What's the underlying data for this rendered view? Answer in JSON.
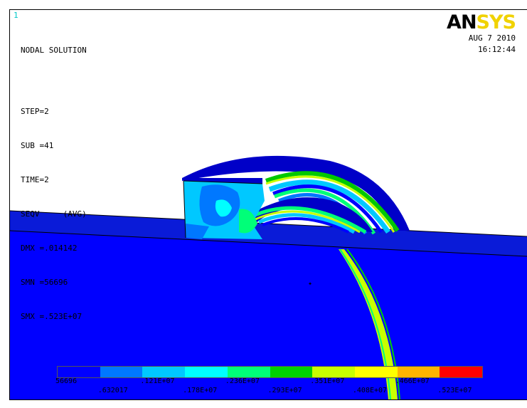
{
  "window_number": "1",
  "header": {
    "title": "NODAL SOLUTION",
    "lines": [
      "STEP=2",
      "SUB =41",
      "TIME=2",
      "SEQV     (AVG)",
      "DMX =.014142",
      "SMN =56696",
      "SMX =.523E+07"
    ]
  },
  "logo": {
    "an": "AN",
    "sys": "SYS"
  },
  "date": {
    "day": "AUG  7 2010",
    "time": "16:12:44"
  },
  "legend": {
    "colors": [
      "#0000ff",
      "#0078ff",
      "#00c8ff",
      "#00ffff",
      "#00ff78",
      "#00d200",
      "#c8ff00",
      "#ffff00",
      "#ffb400",
      "#ff0000"
    ],
    "labels_top": [
      "56696",
      ".121E+07",
      ".236E+07",
      ".351E+07",
      ".466E+07"
    ],
    "labels_bottom": [
      ".632017",
      ".178E+07",
      ".293E+07",
      ".408E+07",
      ".523E+07"
    ]
  }
}
